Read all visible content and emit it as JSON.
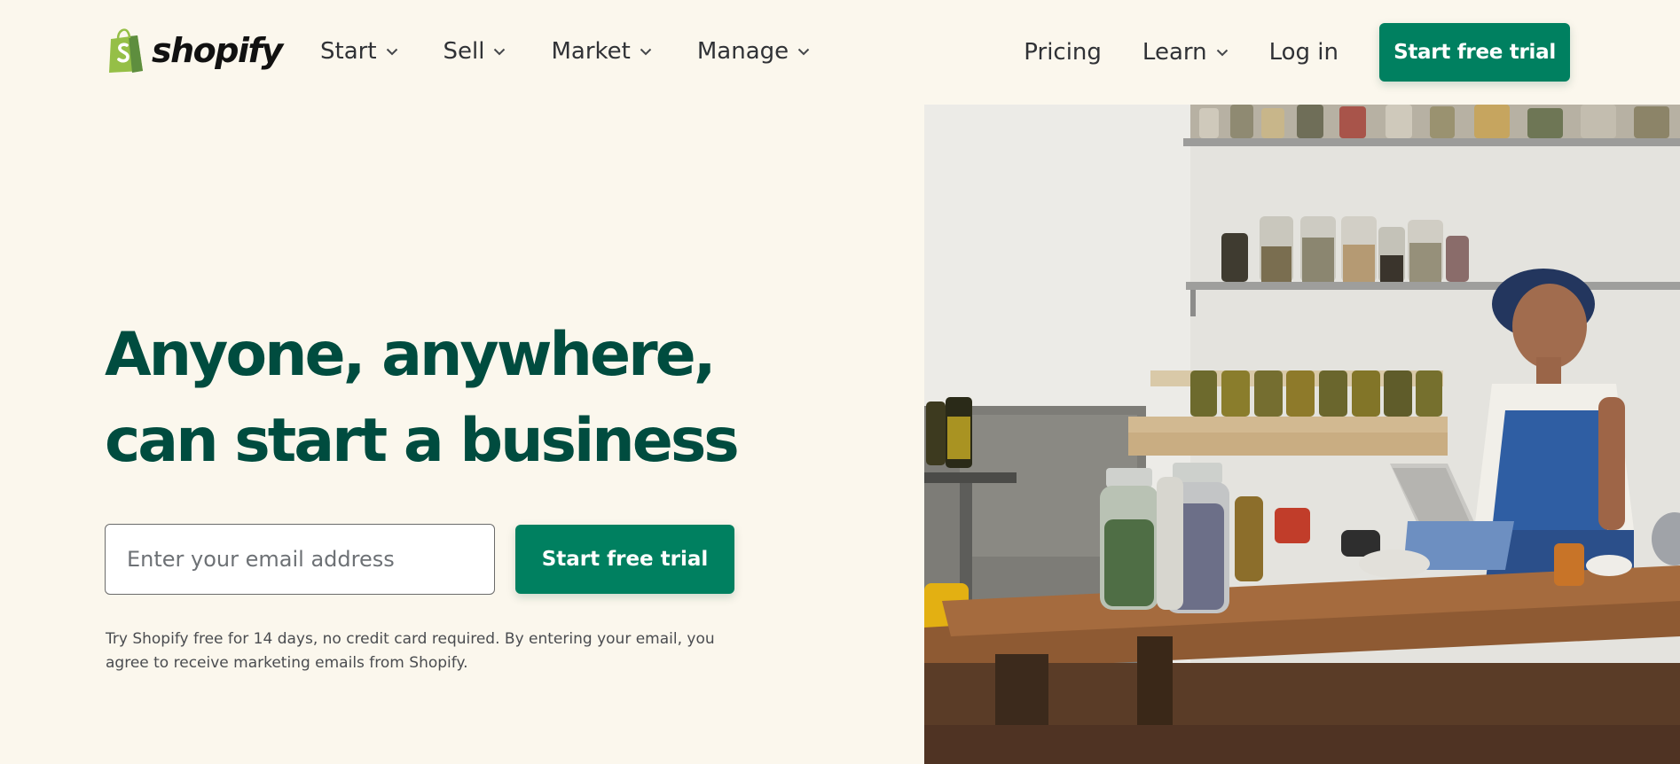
{
  "brand": {
    "name": "shopify",
    "accent": "#008060",
    "heading_color": "#004c3f",
    "logo_green": "#95bf47",
    "logo_icon": "shopping-bag-logo"
  },
  "nav": {
    "left": [
      {
        "label": "Start"
      },
      {
        "label": "Sell"
      },
      {
        "label": "Market"
      },
      {
        "label": "Manage"
      }
    ],
    "right": {
      "pricing": "Pricing",
      "learn": "Learn",
      "login": "Log in",
      "cta": "Start free trial"
    }
  },
  "hero": {
    "title_line1": "Anyone, anywhere,",
    "title_line2": "can start a business",
    "email_placeholder": "Enter your email address",
    "cta": "Start free trial",
    "disclaimer": "Try Shopify free for 14 days, no credit card required. By entering your email, you agree to receive marketing emails from Shopify."
  },
  "photo": {
    "subject": "woman-working-at-laptop-with-herb-jars"
  }
}
